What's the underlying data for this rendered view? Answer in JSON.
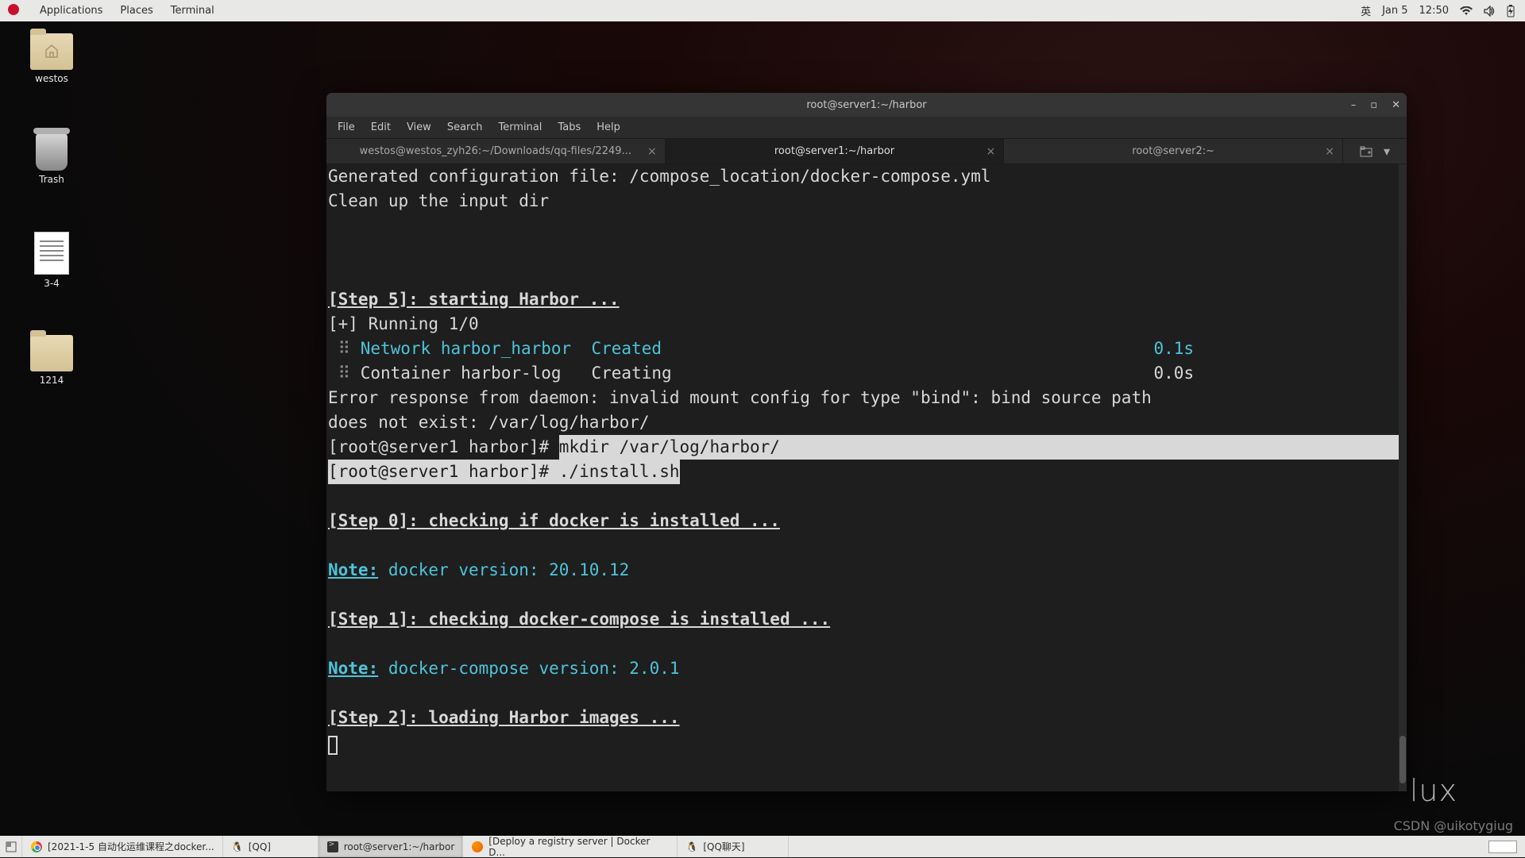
{
  "topbar": {
    "menu": [
      "Applications",
      "Places",
      "Terminal"
    ],
    "ime": "英",
    "date": "Jan 5",
    "time": "12:50"
  },
  "desktop_icons": {
    "westos": "westos",
    "trash": "Trash",
    "doc1": "3-4",
    "folder2": "1214"
  },
  "window": {
    "title": "root@server1:~/harbor",
    "menus": [
      "File",
      "Edit",
      "View",
      "Search",
      "Terminal",
      "Tabs",
      "Help"
    ],
    "tabs": [
      {
        "label": "westos@westos_zyh26:~/Downloads/qq-files/2249...",
        "active": false
      },
      {
        "label": "root@server1:~/harbor",
        "active": true
      },
      {
        "label": "root@server2:~",
        "active": false
      }
    ]
  },
  "terminal": {
    "line_gen": "Generated configuration file: /compose_location/docker-compose.yml",
    "line_clean": "Clean up the input dir",
    "step5": "[Step 5]: starting Harbor ...",
    "running": "[+] Running 1/0",
    "net": " Network harbor_harbor  Created",
    "net_time": "0.1s",
    "cont": "Container harbor-log   Creating",
    "cont_time": "0.0s",
    "err1": "Error response from daemon: invalid mount config for type \"bind\": bind source path ",
    "err2": "does not exist: /var/log/harbor/",
    "prompt1": "[root@server1 harbor]# ",
    "cmd1": "mkdir /var/log/harbor/",
    "prompt2": "[root@server1 harbor]# ./install.sh",
    "step0": "[Step 0]: checking if docker is installed ...",
    "note": "Note:",
    "docker_ver": " docker version: 20.10.12",
    "step1": "[Step 1]: checking docker-compose is installed ...",
    "compose_ver": " docker-compose version: 2.0.1",
    "step2": "[Step 2]: loading Harbor images ..."
  },
  "bottom_panel": {
    "tasks": [
      {
        "label": "[2021-1-5 自动化运维课程之docker..."
      },
      {
        "label": "[QQ]"
      },
      {
        "label": "root@server1:~/harbor"
      },
      {
        "label": "[Deploy a registry server | Docker D..."
      },
      {
        "label": "[QQ聊天]"
      }
    ]
  },
  "watermark": {
    "linux": "lux",
    "csdn": "CSDN @uikotygiug"
  }
}
